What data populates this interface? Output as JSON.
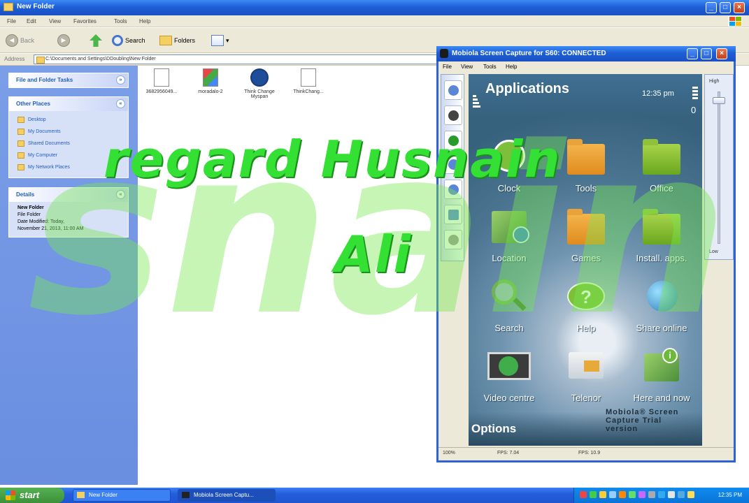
{
  "explorer": {
    "title": "New Folder",
    "menu": [
      "File",
      "Edit",
      "View",
      "Favorites",
      "Tools",
      "Help"
    ],
    "toolbar": {
      "back": "Back",
      "search": "Search",
      "folders": "Folders"
    },
    "address_label": "Address",
    "address_value": "C:\\Documents and Settings\\DDoubling\\New Folder",
    "task_pane": {
      "file_tasks_title": "File and Folder Tasks",
      "other_places_title": "Other Places",
      "other_places": [
        "Desktop",
        "My Documents",
        "Shared Documents",
        "My Computer",
        "My Network Places"
      ],
      "details_title": "Details",
      "details_name": "New Folder",
      "details_type": "File Folder",
      "details_modified": "Date Modified: Today,",
      "details_date": "November 21, 2013, 11:00 AM"
    },
    "files": [
      "3682956049...",
      "moradalo-2",
      "Think Change Myspan",
      "ThinkChang..."
    ]
  },
  "watermark": {
    "line1": "regard Husnain",
    "line2": "Ali",
    "background_word": "snain"
  },
  "mobiola": {
    "title": "Mobiola Screen Capture for S60: CONNECTED",
    "menu": [
      "File",
      "View",
      "Tools",
      "Help"
    ],
    "zoom_high": "High",
    "zoom_low": "Low",
    "phone": {
      "header": "Applications",
      "time": "12:35 pm",
      "signal": "0",
      "apps": [
        "Clock",
        "Tools",
        "Office",
        "Location",
        "Games",
        "Install. apps.",
        "Search",
        "Help",
        "Share online",
        "Video centre",
        "Telenor",
        "Here and now"
      ],
      "options": "Options",
      "trial": "Mobiola® Screen Capture Trial version"
    },
    "status": {
      "zoom": "100%",
      "fps_left": "FPS: 7.04",
      "fps_right": "FPS: 10.9"
    }
  },
  "taskbar": {
    "start": "start",
    "tasks": [
      "New Folder",
      "Mobiola Screen Captu..."
    ],
    "clock": "12:35 PM"
  },
  "colors": {
    "xp_blue": "#245edb",
    "watermark_green": "#33e033",
    "start_green": "#3c9139"
  }
}
